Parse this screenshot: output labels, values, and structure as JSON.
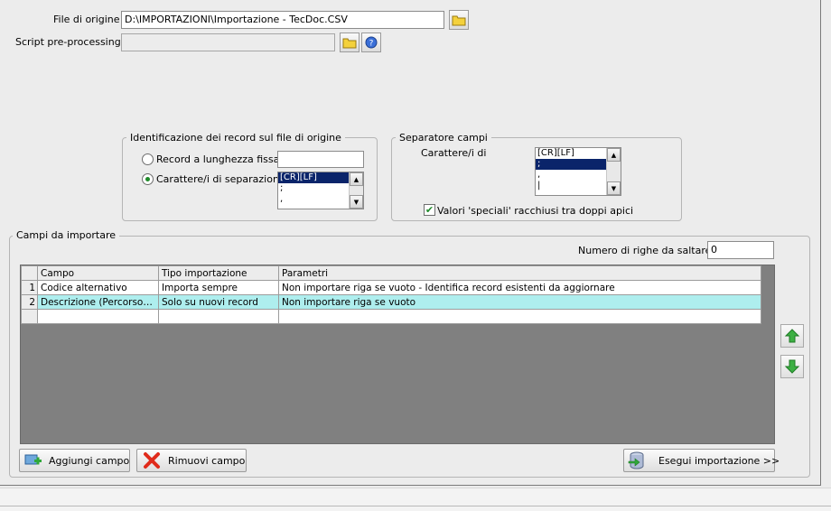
{
  "source": {
    "file_label": "File di origine :",
    "file_value": "D:\\IMPORTAZIONI\\Importazione - TecDoc.CSV",
    "script_label": "Script pre-processing :",
    "script_value": ""
  },
  "record_group": {
    "title": "Identificazione dei record sul file di origine",
    "fixed_label": "Record a lunghezza fissa",
    "fixed_value": "",
    "sep_label": "Carattere/i di separazione",
    "sep_options": [
      "[CR][LF]",
      ";",
      ","
    ]
  },
  "field_sep_group": {
    "title": "Separatore campi",
    "chars_label": "Carattere/i di",
    "options": [
      "[CR][LF]",
      ";",
      ",",
      "|"
    ],
    "quotes_label": "Valori 'speciali' racchiusi tra doppi apici",
    "quotes_checked": true
  },
  "fields_group": {
    "title": "Campi da importare",
    "skip_rows_label": "Numero di righe da saltare  :",
    "skip_rows_value": "0",
    "columns": [
      "Campo",
      "Tipo importazione",
      "Parametri"
    ],
    "rows": [
      {
        "num": "1",
        "campo": "Codice alternativo",
        "tipo": "Importa sempre",
        "parametri": "Non importare riga se vuoto - Identifica record esistenti da aggiornare"
      },
      {
        "num": "2",
        "campo": "Descrizione (Percorso c...",
        "tipo": "Solo su nuovi record",
        "parametri": "Non importare riga se vuoto"
      }
    ]
  },
  "buttons": {
    "add": "Aggiungi campo",
    "remove": "Rimuovi campo",
    "execute": "Esegui importazione >>"
  },
  "colors": {
    "accent_green": "#1f8a2a",
    "selection": "#0a246a",
    "highlight_row": "#aeeeee",
    "grid_background": "#808080"
  },
  "icons": {
    "folder": "folder-icon",
    "help": "help-icon",
    "add": "add-field-icon",
    "remove": "remove-field-icon",
    "execute": "database-import-icon",
    "up": "arrow-up-icon",
    "down": "arrow-down-icon"
  }
}
